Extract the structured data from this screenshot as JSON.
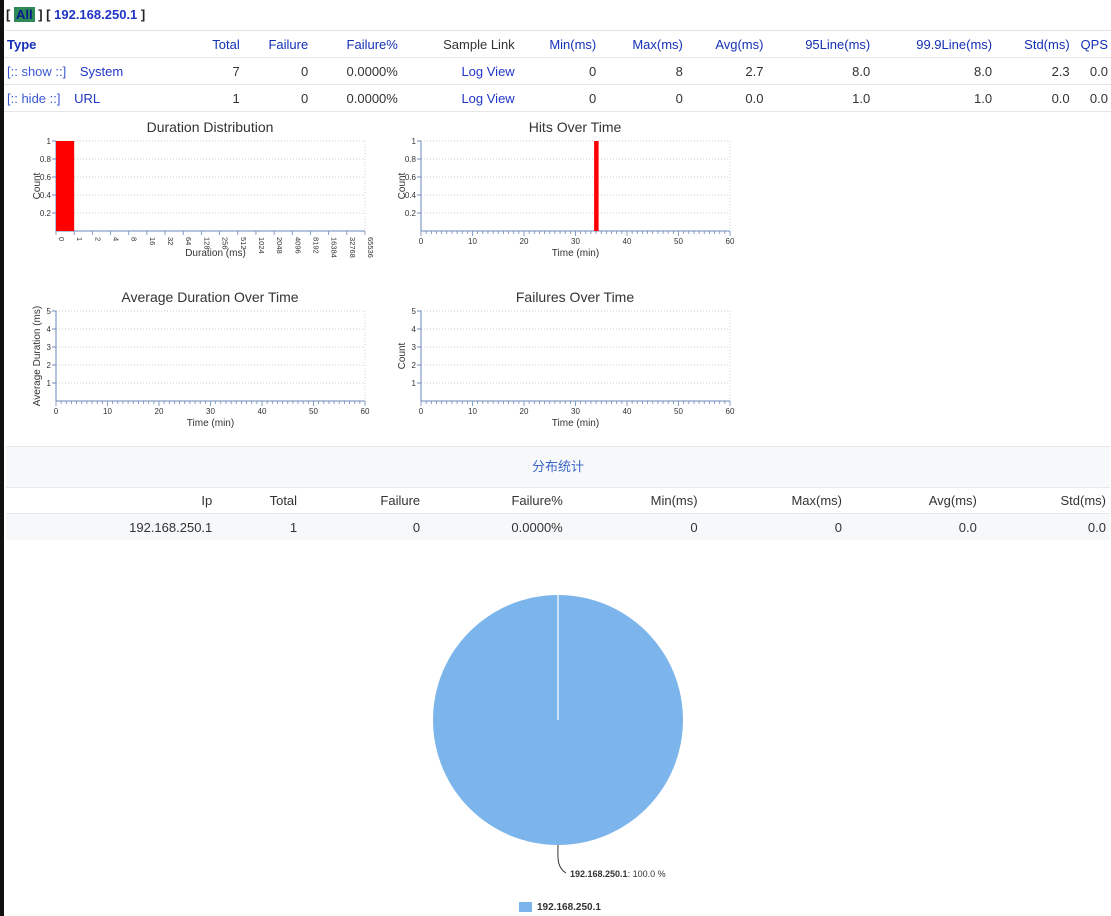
{
  "nav": {
    "open": "[",
    "all": "All",
    "mid": "] [",
    "ip": "192.168.250.1",
    "close": "]"
  },
  "columns": [
    "Type",
    "Total",
    "Failure",
    "Failure%",
    "Sample Link",
    "Min(ms)",
    "Max(ms)",
    "Avg(ms)",
    "95Line(ms)",
    "99.9Line(ms)",
    "Std(ms)",
    "QPS"
  ],
  "rows": [
    {
      "toggle": "[:: show ::]",
      "type": "System",
      "total": "7",
      "failure": "0",
      "failure_pct": "0.0000%",
      "link": "Log View",
      "min": "0",
      "max": "8",
      "avg": "2.7",
      "line95": "8.0",
      "line999": "8.0",
      "std": "2.3",
      "qps": "0.0"
    },
    {
      "toggle": "[:: hide ::]",
      "type": "URL",
      "total": "1",
      "failure": "0",
      "failure_pct": "0.0000%",
      "link": "Log View",
      "min": "0",
      "max": "0",
      "avg": "0.0",
      "line95": "1.0",
      "line999": "1.0",
      "std": "0.0",
      "qps": "0.0"
    }
  ],
  "distribution": {
    "title": "分布统计",
    "columns": [
      "Ip",
      "Total",
      "Failure",
      "Failure%",
      "Min(ms)",
      "Max(ms)",
      "Avg(ms)",
      "Std(ms)"
    ],
    "rows": [
      [
        "192.168.250.1",
        "1",
        "0",
        "0.0000%",
        "0",
        "0",
        "0.0",
        "0.0"
      ]
    ]
  },
  "colors": {
    "bar": "#ff0000",
    "pie": "#7cb5ec",
    "axis": "#6b8ab8",
    "grid": "#bbbbbb"
  },
  "chart_data": [
    {
      "type": "bar",
      "title": "Duration Distribution",
      "xlabel": "Duration (ms)",
      "ylabel": "Count",
      "ylim": [
        0,
        1
      ],
      "yticks": [
        "0.2",
        "0.4",
        "0.6",
        "0.8",
        "1"
      ],
      "categories": [
        "0",
        "1",
        "2",
        "4",
        "8",
        "16",
        "32",
        "64",
        "128",
        "256",
        "512",
        "1024",
        "2048",
        "4096",
        "8192",
        "16384",
        "32768",
        "65536"
      ],
      "values": [
        1,
        0,
        0,
        0,
        0,
        0,
        0,
        0,
        0,
        0,
        0,
        0,
        0,
        0,
        0,
        0,
        0,
        0
      ],
      "grid": true
    },
    {
      "type": "bar",
      "title": "Hits Over Time",
      "xlabel": "Time (min)",
      "ylabel": "Count",
      "xlim": [
        0,
        60
      ],
      "ylim": [
        0,
        1
      ],
      "xticks": [
        "0",
        "10",
        "20",
        "30",
        "40",
        "50",
        "60"
      ],
      "yticks": [
        "0.2",
        "0.4",
        "0.6",
        "0.8",
        "1"
      ],
      "points": [
        {
          "x": 34,
          "y": 1
        }
      ],
      "grid": true
    },
    {
      "type": "line",
      "title": "Average Duration Over Time",
      "xlabel": "Time (min)",
      "ylabel": "Average Duration (ms)",
      "xlim": [
        0,
        60
      ],
      "ylim": [
        0,
        5
      ],
      "xticks": [
        "0",
        "10",
        "20",
        "30",
        "40",
        "50",
        "60"
      ],
      "yticks": [
        "1",
        "2",
        "3",
        "4",
        "5"
      ],
      "points": [],
      "grid": true
    },
    {
      "type": "line",
      "title": "Failures Over Time",
      "xlabel": "Time (min)",
      "ylabel": "Count",
      "xlim": [
        0,
        60
      ],
      "ylim": [
        0,
        5
      ],
      "xticks": [
        "0",
        "10",
        "20",
        "30",
        "40",
        "50",
        "60"
      ],
      "yticks": [
        "1",
        "2",
        "3",
        "4",
        "5"
      ],
      "points": [],
      "grid": true
    },
    {
      "type": "pie",
      "slices": [
        {
          "label": "192.168.250.1",
          "value": 100.0,
          "label_suffix": ": 100.0 %"
        }
      ],
      "legend": [
        "192.168.250.1"
      ],
      "legend_position": "bottom"
    }
  ]
}
